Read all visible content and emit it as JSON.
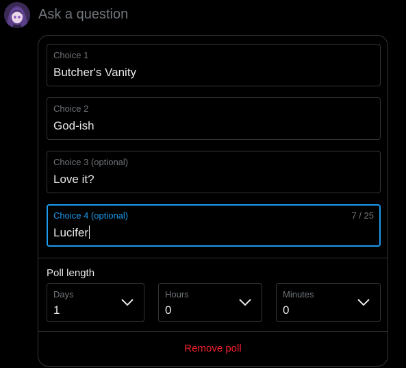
{
  "composer": {
    "placeholder": "Ask a question",
    "avatar_icon": "user-avatar"
  },
  "poll": {
    "choices": [
      {
        "label": "Choice 1",
        "value": "Butcher's Vanity"
      },
      {
        "label": "Choice 2",
        "value": "God-ish"
      },
      {
        "label": "Choice 3 (optional)",
        "value": "Love it?"
      },
      {
        "label": "Choice 4 (optional)",
        "value": "Lucifer",
        "counter": "7 / 25",
        "focused": true
      }
    ],
    "length": {
      "title": "Poll length",
      "days": {
        "label": "Days",
        "value": "1"
      },
      "hours": {
        "label": "Hours",
        "value": "0"
      },
      "minutes": {
        "label": "Minutes",
        "value": "0"
      }
    },
    "remove_label": "Remove poll"
  },
  "colors": {
    "accent": "#1d9bf0",
    "danger": "#f4212e",
    "border": "#333639",
    "muted": "#71767b",
    "text": "#e7e9ea",
    "background": "#000000"
  }
}
